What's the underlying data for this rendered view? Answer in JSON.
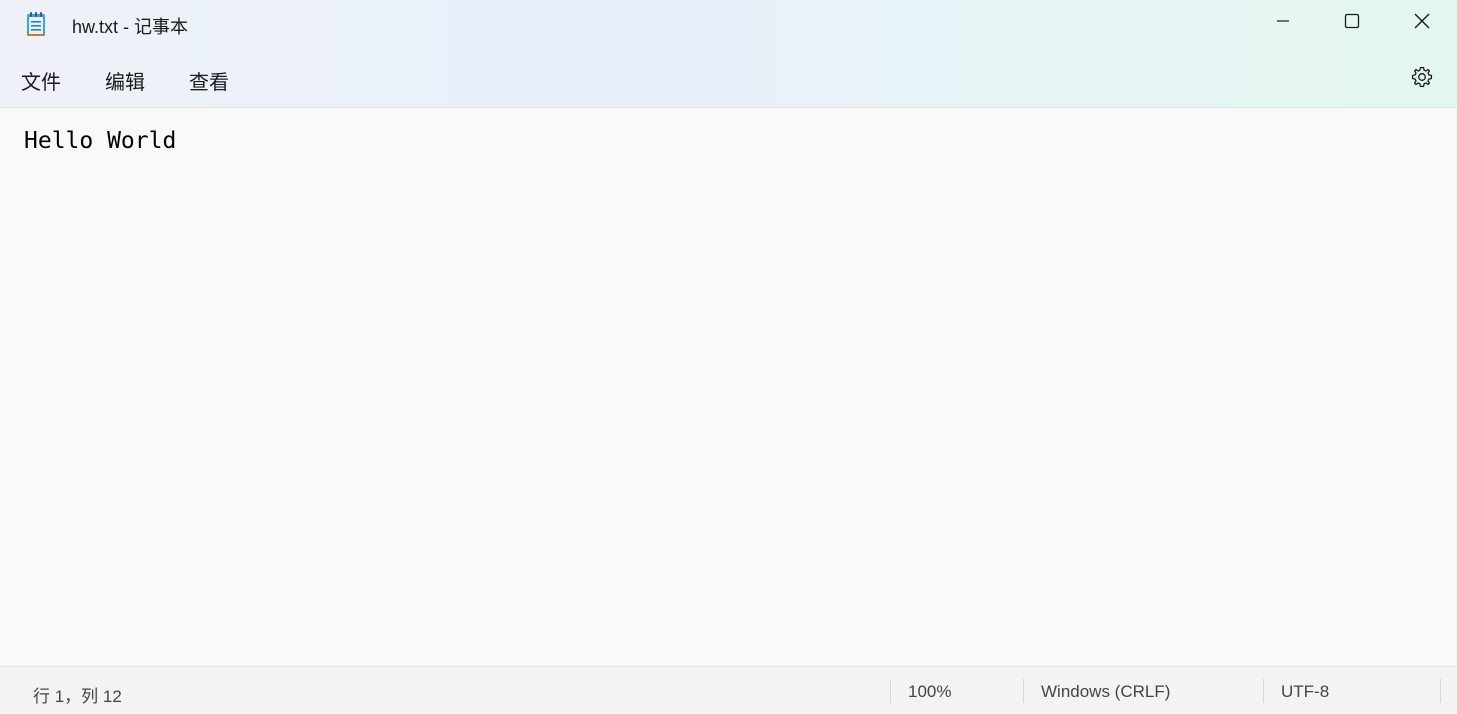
{
  "window": {
    "title": "hw.txt - 记事本"
  },
  "icons": {
    "app": "notepad-icon",
    "minimize": "minimize-icon",
    "maximize": "maximize-icon",
    "close": "close-icon",
    "settings": "gear-icon"
  },
  "menu": {
    "file": "文件",
    "edit": "编辑",
    "view": "查看"
  },
  "editor": {
    "content": "Hello World"
  },
  "status": {
    "position": "行 1，列 12",
    "zoom": "100%",
    "line_ending": "Windows (CRLF)",
    "encoding": "UTF-8"
  },
  "colors": {
    "chrome_gradient_start": "#eef2f8",
    "chrome_gradient_end": "#e4f6f2",
    "editor_bg": "#f9f9f9",
    "statusbar_bg": "#f3f3f3",
    "app_icon_accent": "#2f8fd8"
  }
}
